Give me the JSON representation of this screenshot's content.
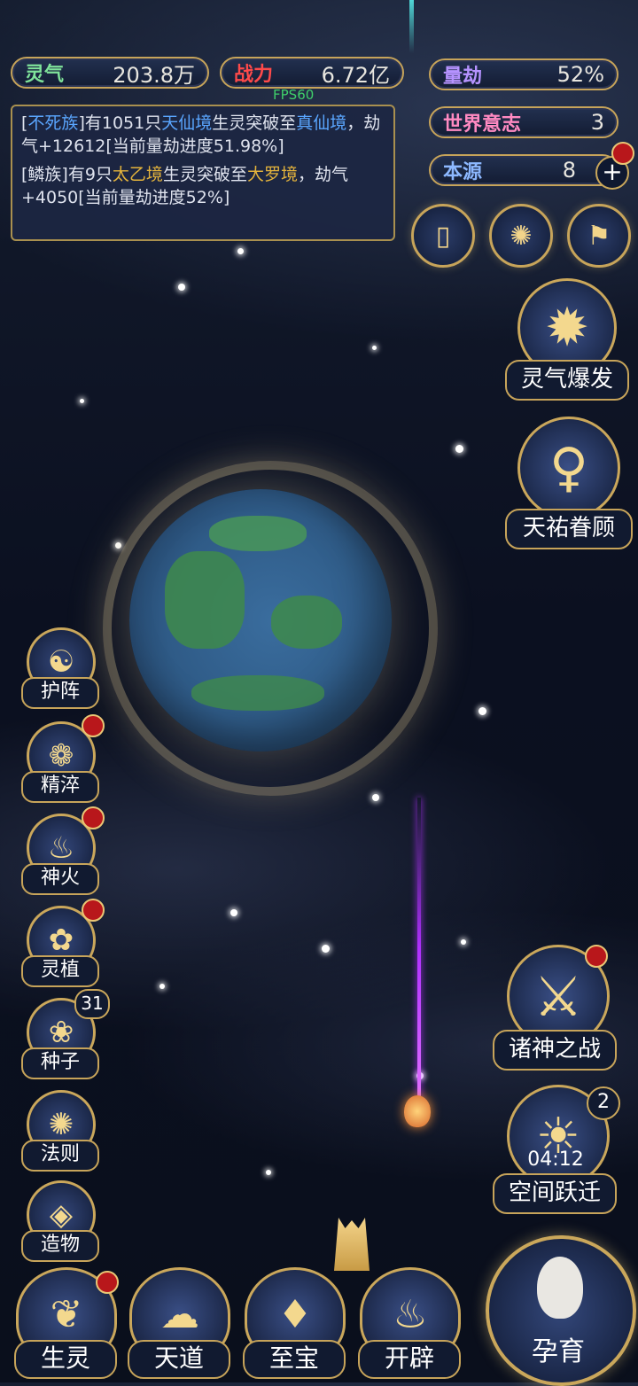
{
  "stats": {
    "lingqi": {
      "label": "灵气",
      "value": "203.8万",
      "color": "#7fe39a"
    },
    "zhanli": {
      "label": "战力",
      "value": "6.72亿",
      "color": "#ff4a4a"
    },
    "liangjie": {
      "label": "量劫",
      "value": "52%",
      "color": "#b693ff"
    },
    "shijie": {
      "label": "世界意志",
      "value": "3",
      "color": "#ff8ac2"
    },
    "benyuan": {
      "label": "本源",
      "value": "8",
      "color": "#8db8ff"
    }
  },
  "fps": "FPS60",
  "log": {
    "l1": {
      "a": "[",
      "race": "不死族",
      "b": "]有1051只",
      "realm1": "天仙境",
      "c": "生灵突破至",
      "realm2": "真仙境",
      "d": "，劫气+12612[当前量劫进度51.98%]"
    },
    "l2": {
      "a": "[鳞族]有9只",
      "realm1": "太乙境",
      "c": "生灵突破至",
      "realm2": "大罗境",
      "d": "，劫气+4050[当前量劫进度52%]"
    }
  },
  "side_left": [
    {
      "label": "护阵",
      "icon": "yin-yang-icon",
      "glyph": "☯",
      "badge": false
    },
    {
      "label": "精淬",
      "icon": "lotus-icon",
      "glyph": "❁",
      "badge": true
    },
    {
      "label": "神火",
      "icon": "flame-icon",
      "glyph": "♨",
      "badge": true
    },
    {
      "label": "灵植",
      "icon": "plant-icon",
      "glyph": "✿",
      "badge": true
    },
    {
      "label": "种子",
      "icon": "seed-icon",
      "glyph": "❀",
      "badge": false,
      "count": "31"
    },
    {
      "label": "法则",
      "icon": "rule-icon",
      "glyph": "✺",
      "badge": false
    },
    {
      "label": "造物",
      "icon": "create-icon",
      "glyph": "◈",
      "badge": false
    }
  ],
  "side_right": {
    "burst": "灵气爆发",
    "blessing": "天祐眷顾",
    "war": "诸神之战",
    "jump": "空间跃迁",
    "jump_count": "2",
    "jump_timer": "04:12"
  },
  "bottom": [
    "生灵",
    "天道",
    "至宝",
    "开辟"
  ],
  "main_button": "孕育"
}
